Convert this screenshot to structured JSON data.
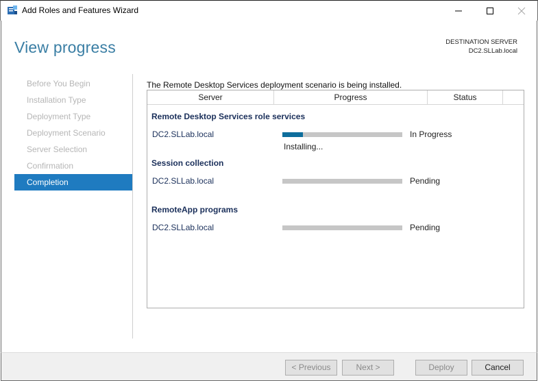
{
  "window": {
    "title": "Add Roles and Features Wizard"
  },
  "header": {
    "page_title": "View progress",
    "destination_label": "DESTINATION SERVER",
    "destination_server": "DC2.SLLab.local"
  },
  "steps": [
    {
      "label": "Before You Begin",
      "active": false
    },
    {
      "label": "Installation Type",
      "active": false
    },
    {
      "label": "Deployment Type",
      "active": false
    },
    {
      "label": "Deployment Scenario",
      "active": false
    },
    {
      "label": "Server Selection",
      "active": false
    },
    {
      "label": "Confirmation",
      "active": false
    },
    {
      "label": "Completion",
      "active": true
    }
  ],
  "content": {
    "intro": "The Remote Desktop Services deployment scenario is being installed.",
    "columns": {
      "server": "Server",
      "progress": "Progress",
      "status": "Status"
    },
    "sections": [
      {
        "title": "Remote Desktop Services role services",
        "server": "DC2.SLLab.local",
        "progress": 0.17,
        "status": "In Progress",
        "subtext": "Installing..."
      },
      {
        "title": "Session collection",
        "server": "DC2.SLLab.local",
        "progress": 0,
        "status": "Pending"
      },
      {
        "title": "RemoteApp programs",
        "server": "DC2.SLLab.local",
        "progress": 0,
        "status": "Pending"
      }
    ]
  },
  "footer": {
    "previous": "< Previous",
    "next": "Next >",
    "deploy": "Deploy",
    "cancel": "Cancel"
  },
  "colors": {
    "accent": "#1f7bc0",
    "progress_fill": "#0e6e9c",
    "title": "#3a7ea4"
  }
}
